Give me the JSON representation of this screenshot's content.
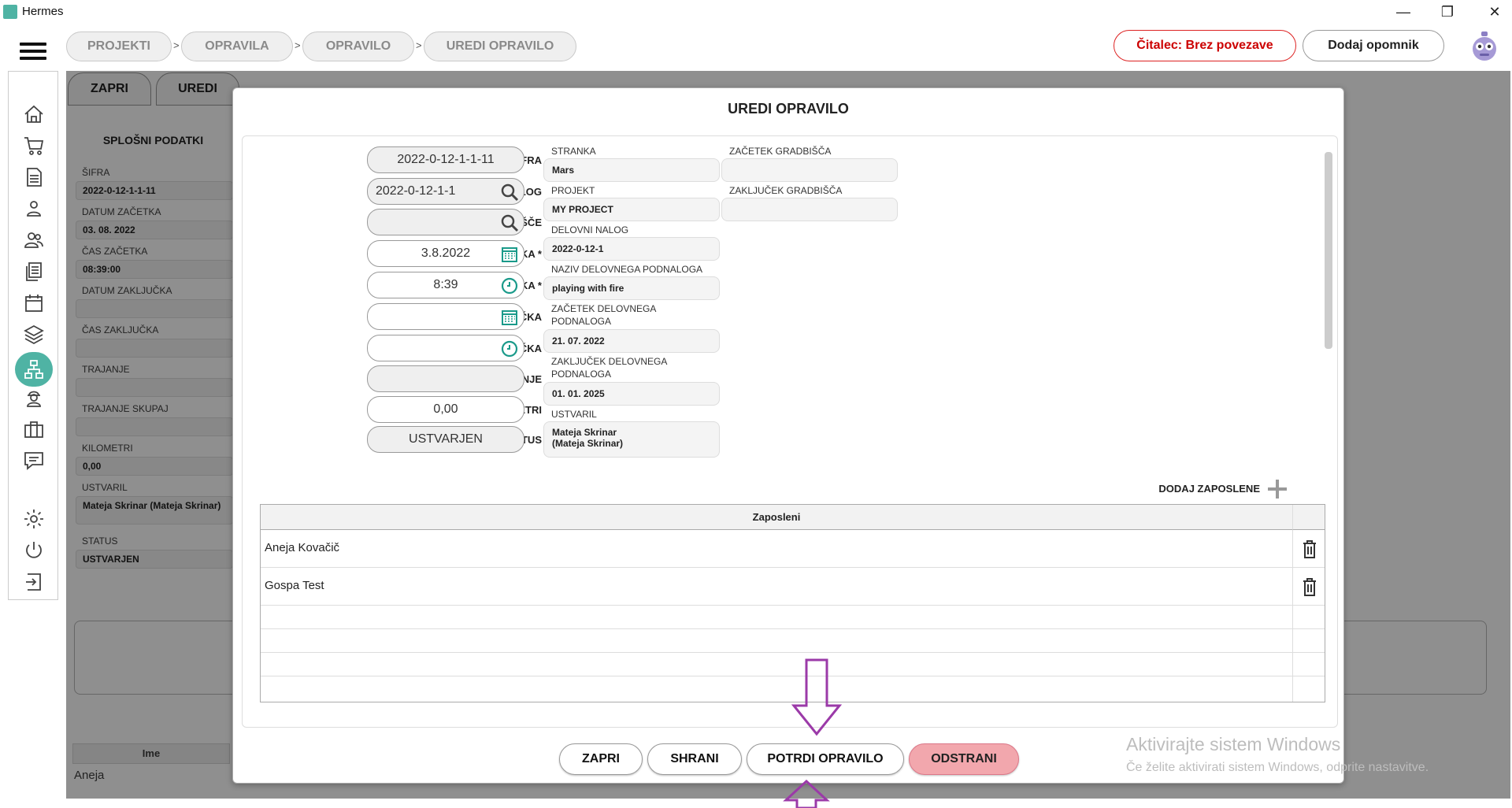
{
  "window": {
    "title": "Hermes",
    "minimize": "—",
    "maximize": "❐",
    "close": "✕"
  },
  "breadcrumb": [
    "PROJEKTI",
    "OPRAVILA",
    "OPRAVILO",
    "UREDI OPRAVILO"
  ],
  "breadcrumb_sep": ">",
  "header": {
    "reader_status": "Čitalec: Brez povezave",
    "add_reminder": "Dodaj opomnik"
  },
  "background": {
    "tabs": [
      "ZAPRI",
      "UREDI"
    ],
    "section_title": "SPLOŠNI PODATKI",
    "fields": [
      {
        "label": "ŠIFRA",
        "value": "2022-0-12-1-1-11"
      },
      {
        "label": "DATUM ZAČETKA",
        "value": "03. 08. 2022"
      },
      {
        "label": "ČAS ZAČETKA",
        "value": "08:39:00"
      },
      {
        "label": "DATUM ZAKLJUČKA",
        "value": ""
      },
      {
        "label": "ČAS ZAKLJUČKA",
        "value": ""
      },
      {
        "label": "TRAJANJE",
        "value": ""
      },
      {
        "label": "TRAJANJE SKUPAJ",
        "value": ""
      },
      {
        "label": "KILOMETRI",
        "value": "0,00"
      },
      {
        "label": "USTVARIL",
        "value": "Mateja Skrinar (Mateja Skrinar)"
      },
      {
        "label": "STATUS",
        "value": "USTVARJEN"
      }
    ],
    "table_header": "Ime",
    "table_row": "Aneja"
  },
  "modal": {
    "title": "UREDI OPRAVILO",
    "form": {
      "sifra": {
        "label": "ŠIFRA",
        "value": "2022-0-12-1-1-11"
      },
      "delovni_podnalog": {
        "label": "DELOVNI PODNALOG",
        "value": "2022-0-12-1-1"
      },
      "gradbisce": {
        "label": "GRADBIŠČE",
        "value": ""
      },
      "datum_zacetka": {
        "label": "DATUM ZAČETKA *",
        "value": "3.8.2022"
      },
      "cas_zacetka": {
        "label": "ČAS ZAČETKA *",
        "value": "8:39"
      },
      "datum_zakljucka": {
        "label": "DATUM ZAKLJUČKA",
        "value": ""
      },
      "cas_zakljucka": {
        "label": "ČAS ZAKLJUČKA",
        "value": ""
      },
      "trajanje": {
        "label": "TRAJANJE",
        "value": ""
      },
      "kilometri": {
        "label": "KILOMETRI",
        "value": "0,00"
      },
      "status": {
        "label": "STATUS",
        "value": "USTVARJEN"
      }
    },
    "info": {
      "stranka": {
        "label": "STRANKA",
        "value": "Mars"
      },
      "projekt": {
        "label": "PROJEKT",
        "value": "MY PROJECT"
      },
      "delovni_nalog": {
        "label": "DELOVNI NALOG",
        "value": "2022-0-12-1"
      },
      "naziv": {
        "label": "NAZIV DELOVNEGA PODNALOGA",
        "value": "playing with fire"
      },
      "zacetek_podnaloga_l1": "ZAČETEK DELOVNEGA",
      "zacetek_podnaloga_l2": "PODNALOGA",
      "zacetek_podnaloga_val": "21. 07. 2022",
      "zakljucek_podnaloga_l1": "ZAKLJUČEK DELOVNEGA",
      "zakljucek_podnaloga_l2": "PODNALOGA",
      "zakljucek_podnaloga_val": "01. 01. 2025",
      "ustvaril_label": "USTVARIL",
      "ustvaril_l1": "Mateja Skrinar",
      "ustvaril_l2": "(Mateja Skrinar)",
      "zacetek_gradbisca": {
        "label": "ZAČETEK GRADBIŠČA",
        "value": ""
      },
      "zakljucek_gradbisca": {
        "label": "ZAKLJUČEK GRADBIŠČA",
        "value": ""
      }
    },
    "add_employees": "DODAJ ZAPOSLENE",
    "employees_header": "Zaposleni",
    "employees": [
      "Aneja  Kovačič",
      "Gospa Test"
    ],
    "buttons": {
      "close": "ZAPRI",
      "save": "SHRANI",
      "confirm": "POTRDI OPRAVILO",
      "delete": "ODSTRANI"
    }
  },
  "watermark": {
    "line1": "Aktivirajte sistem Windows",
    "line2": "Če želite aktivirati sistem Windows, odprite nastavitve."
  },
  "colors": {
    "accent": "#4fb3a4",
    "danger": "#f2a7ad",
    "red_text": "#cc0000",
    "arrow": "#9b3aa8"
  }
}
